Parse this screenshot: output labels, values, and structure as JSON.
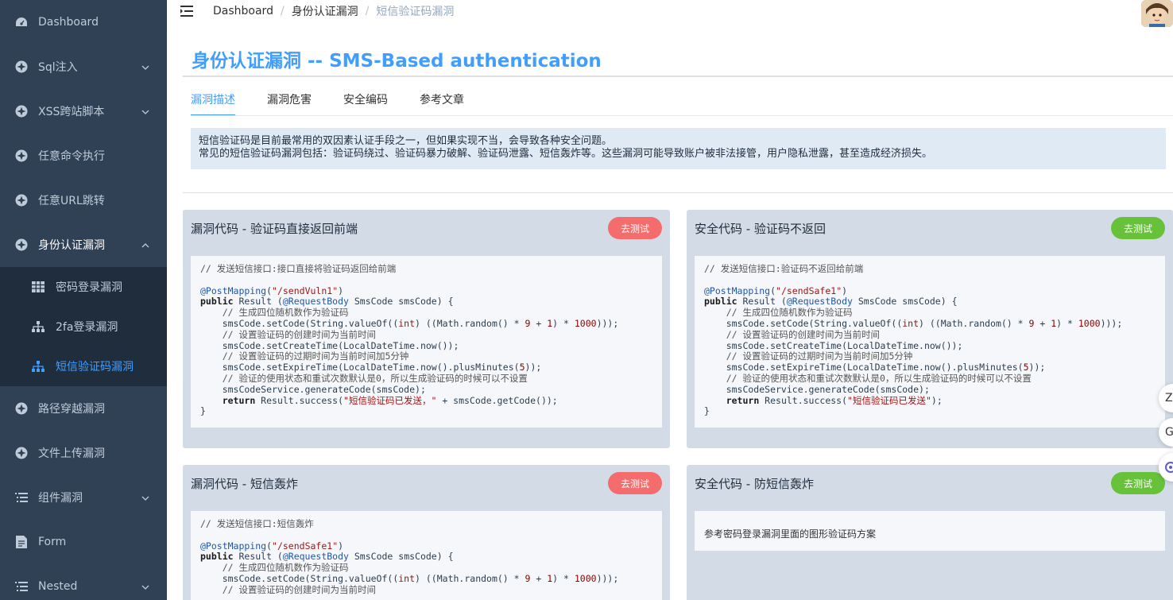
{
  "sidebar": {
    "items": [
      {
        "label": "Dashboard",
        "icon": "dashboard-icon"
      },
      {
        "label": "Sql注入",
        "icon": "component-icon",
        "chevron": "down"
      },
      {
        "label": "XSS跨站脚本",
        "icon": "component-icon",
        "chevron": "down"
      },
      {
        "label": "任意命令执行",
        "icon": "component-icon"
      },
      {
        "label": "任意URL跳转",
        "icon": "component-icon"
      },
      {
        "label": "身份认证漏洞",
        "icon": "component-icon",
        "chevron": "up"
      }
    ],
    "submenu": [
      {
        "label": "密码登录漏洞",
        "icon": "table-icon"
      },
      {
        "label": "2fa登录漏洞",
        "icon": "tree-icon"
      },
      {
        "label": "短信验证码漏洞",
        "icon": "tree-icon",
        "active": true
      }
    ],
    "items_after": [
      {
        "label": "路径穿越漏洞",
        "icon": "component-icon"
      },
      {
        "label": "文件上传漏洞",
        "icon": "component-icon"
      },
      {
        "label": "组件漏洞",
        "icon": "list-icon",
        "chevron": "down"
      },
      {
        "label": "Form",
        "icon": "form-icon"
      },
      {
        "label": "Nested",
        "icon": "list-icon",
        "chevron": "down"
      }
    ],
    "active_color": "#409eff"
  },
  "header": {
    "breadcrumb": [
      "Dashboard",
      "身份认证漏洞",
      "短信验证码漏洞"
    ]
  },
  "page": {
    "title": "身份认证漏洞 -- SMS-Based authentication",
    "tabs": [
      "漏洞描述",
      "漏洞危害",
      "安全编码",
      "参考文章"
    ],
    "active_tab": "漏洞描述",
    "description": [
      "短信验证码是目前最常用的双因素认证手段之一，但如果实现不当，会导致各种安全问题。",
      "常见的短信验证码漏洞包括：验证码绕过、验证码暴力破解、验证码泄露、短信轰炸等。这些漏洞可能导致账户被非法接管，用户隐私泄露，甚至造成经济损失。"
    ]
  },
  "cards": [
    {
      "title": "漏洞代码 - 验证码直接返回前端",
      "button": "去测试",
      "button_type": "danger",
      "code": "// 发送短信接口:接口直接将验证码返回给前端\n\n@PostMapping(\"/sendVuln1\")\npublic Result sendVuln1(@RequestBody SmsCode smsCode) {\n    // 生成四位随机数作为验证码\n    smsCode.setCode(String.valueOf((int) ((Math.random() * 9 + 1) * 1000)));\n    // 设置验证码的创建时间为当前时间\n    smsCode.setCreateTime(LocalDateTime.now());\n    // 设置验证码的过期时间为当前时间加5分钟\n    smsCode.setExpireTime(LocalDateTime.now().plusMinutes(5));\n    // 验证的使用状态和重试次数默认是0，所以生成验证码的时候可以不设置\n    smsCodeService.generateCode(smsCode);\n    return Result.success(\"短信验证码已发送，\" + smsCode.getCode());\n}"
    },
    {
      "title": "安全代码 - 验证码不返回",
      "button": "去测试",
      "button_type": "success",
      "code": "// 发送短信接口:验证码不返回给前端\n\n@PostMapping(\"/sendSafe1\")\npublic Result sendSafe1(@RequestBody SmsCode smsCode) {\n    // 生成四位随机数作为验证码\n    smsCode.setCode(String.valueOf((int) ((Math.random() * 9 + 1) * 1000)));\n    // 设置验证码的创建时间为当前时间\n    smsCode.setCreateTime(LocalDateTime.now());\n    // 设置验证码的过期时间为当前时间加5分钟\n    smsCode.setExpireTime(LocalDateTime.now().plusMinutes(5));\n    // 验证的使用状态和重试次数默认是0，所以生成验证码的时候可以不设置\n    smsCodeService.generateCode(smsCode);\n    return Result.success(\"短信验证码已发送\");\n}"
    },
    {
      "title": "漏洞代码 - 短信轰炸",
      "button": "去测试",
      "button_type": "danger",
      "code": "// 发送短信接口:短信轰炸\n\n@PostMapping(\"/sendSafe1\")\npublic Result sendSafe1(@RequestBody SmsCode smsCode) {\n    // 生成四位随机数作为验证码\n    smsCode.setCode(String.valueOf((int) ((Math.random() * 9 + 1) * 1000)));\n    // 设置验证码的创建时间为当前时间"
    },
    {
      "title": "安全代码 - 防短信轰炸",
      "button": "去测试",
      "button_type": "success",
      "text": "参考密码登录漏洞里面的图形验证码方案"
    }
  ],
  "floating": {
    "buttons": [
      "zh-icon",
      "translate-icon",
      "ai-assistant-icon"
    ],
    "labels": [
      "Z",
      "G"
    ]
  }
}
